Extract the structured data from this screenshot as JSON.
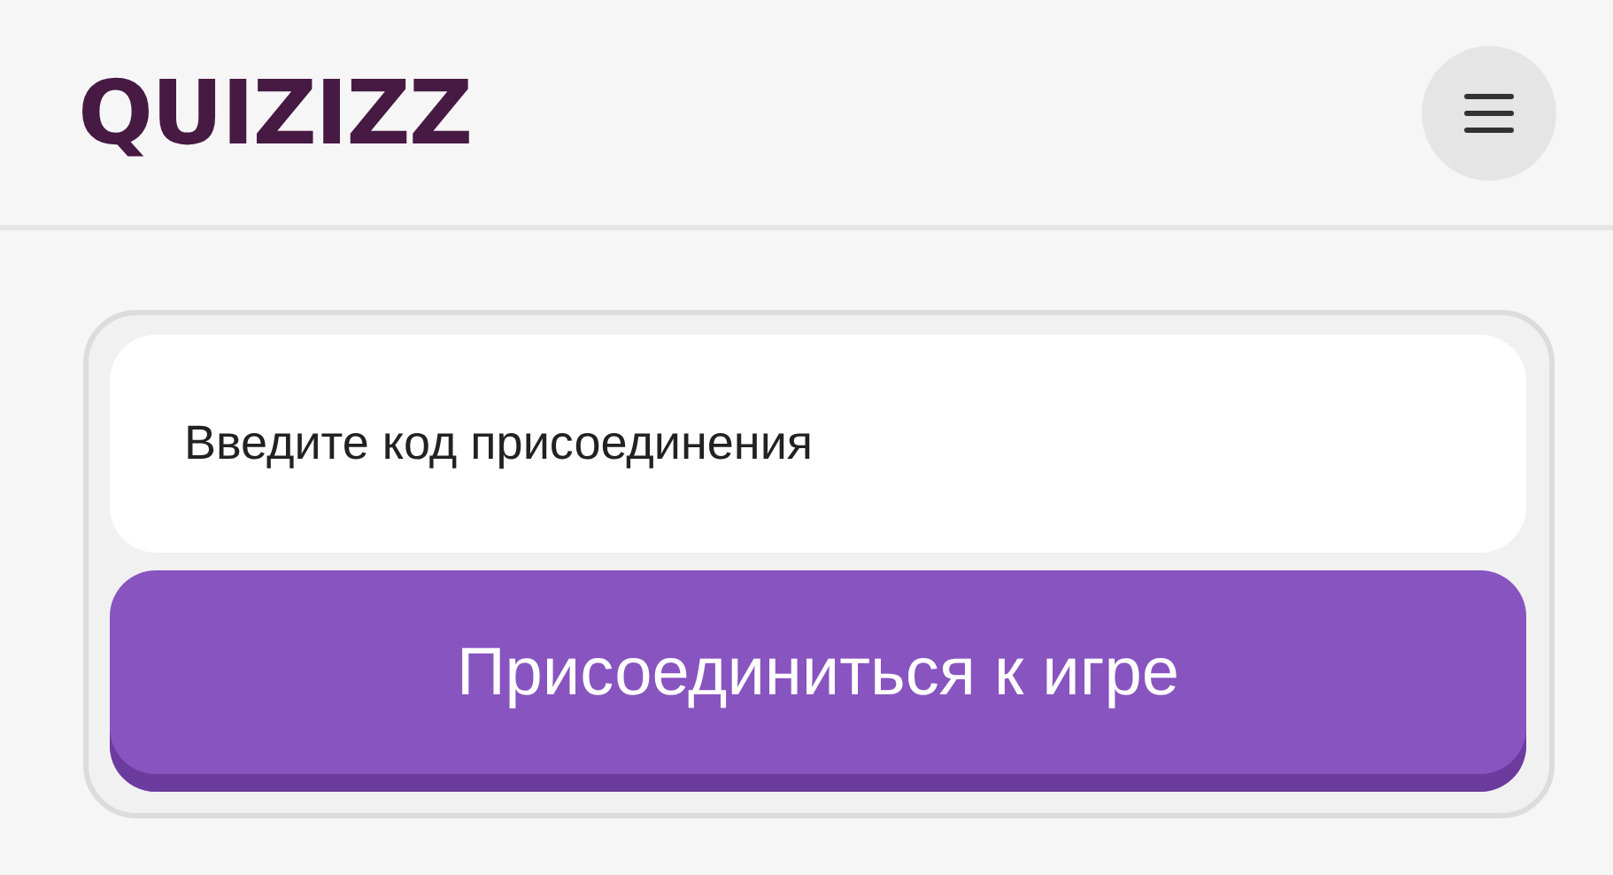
{
  "header": {
    "logo": "QUIZIZZ"
  },
  "join_form": {
    "code_field": {
      "placeholder": "Введите код присоединения"
    },
    "join_button": "Присоединиться к игре"
  }
}
